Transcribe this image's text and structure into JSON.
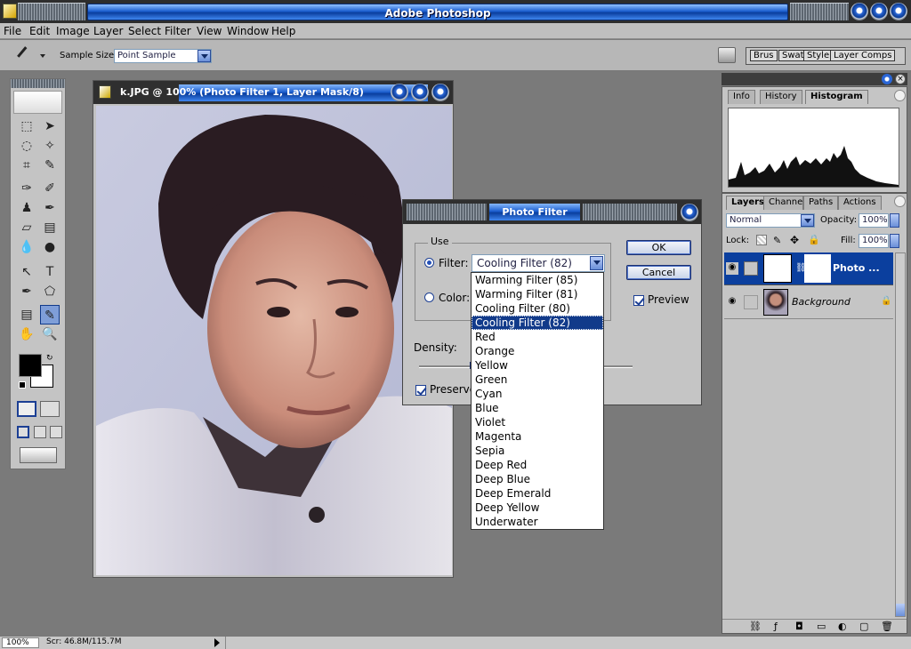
{
  "app": {
    "title": "Adobe Photoshop"
  },
  "menu": [
    "File",
    "Edit",
    "Image",
    "Layer",
    "Select",
    "Filter",
    "View",
    "Window",
    "Help"
  ],
  "options_bar": {
    "sample_size_label": "Sample Size:",
    "sample_size_value": "Point Sample"
  },
  "palette_well": [
    "Brus",
    "Swat",
    "Style",
    "Layer Comps"
  ],
  "document": {
    "title": "k.JPG @ 100% (Photo Filter 1, Layer Mask/8)"
  },
  "photo_filter": {
    "title": "Photo Filter",
    "use_label": "Use",
    "filter_label": "Filter:",
    "filter_value": "Cooling Filter (82)",
    "color_label": "Color:",
    "density_label": "Density:",
    "preserve_label": "Preserve",
    "ok_label": "OK",
    "cancel_label": "Cancel",
    "preview_label": "Preview",
    "density_fraction": 0.25,
    "options": [
      "Warming Filter (85)",
      "Warming Filter (81)",
      "Cooling Filter (80)",
      "Cooling Filter (82)",
      "Red",
      "Orange",
      "Yellow",
      "Green",
      "Cyan",
      "Blue",
      "Violet",
      "Magenta",
      "Sepia",
      "Deep Red",
      "Deep Blue",
      "Deep Emerald",
      "Deep Yellow",
      "Underwater"
    ],
    "selected_index": 3
  },
  "info_panel": {
    "tabs": [
      "Info",
      "History",
      "Histogram"
    ]
  },
  "layers_panel": {
    "tabs": [
      "Layers",
      "Channels",
      "Paths",
      "Actions"
    ],
    "blend_mode": "Normal",
    "opacity_label": "Opacity:",
    "opacity_value": "100%",
    "lock_label": "Lock:",
    "fill_label": "Fill:",
    "fill_value": "100%",
    "layers": [
      {
        "name": "Photo ..."
      },
      {
        "name": "Background"
      }
    ]
  },
  "status": {
    "zoom": "100%",
    "scratch": "Scr: 46.8M/115.7M"
  },
  "colors": {
    "accent": "#0b3f9e",
    "selection": "#113a8a"
  }
}
